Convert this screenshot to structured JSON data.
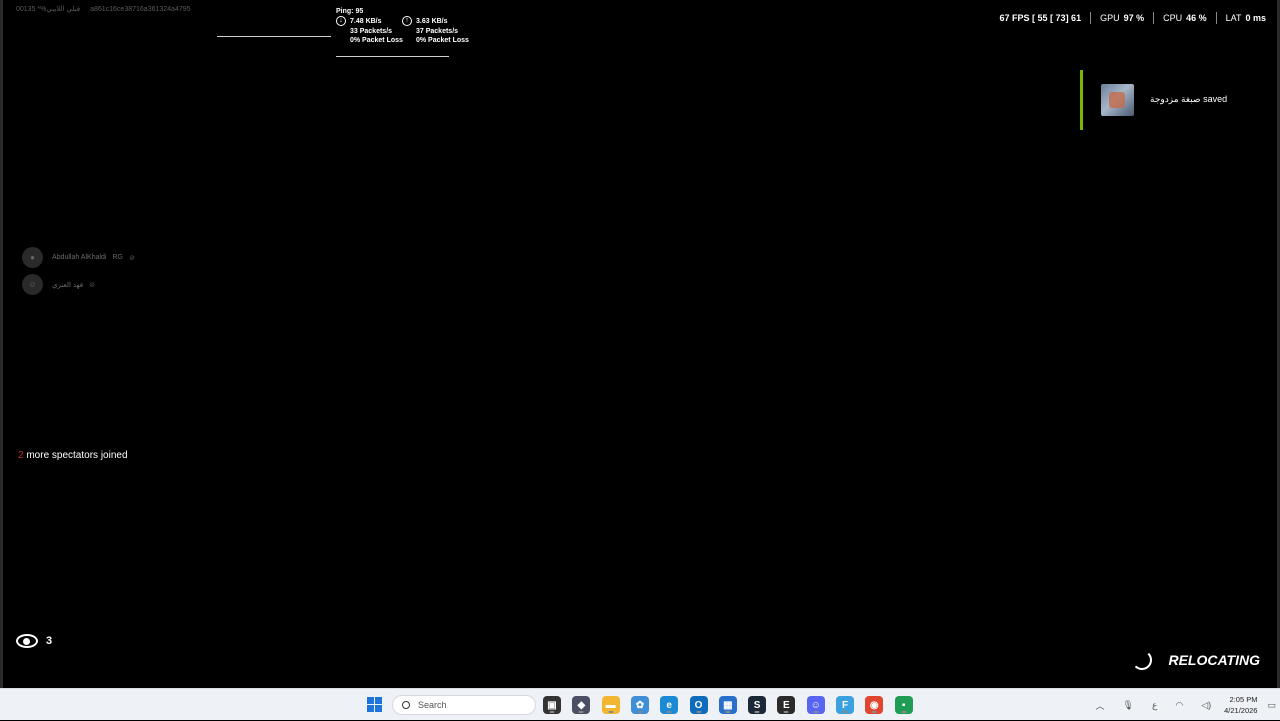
{
  "overlay": {
    "session_name": "قبلي اللايبي%*",
    "session_id": "00135a861c16ce38716a361324a4795",
    "network": {
      "ping": "Ping: 95",
      "download": {
        "rate": "7.48 KB/s",
        "packets": "33 Packets/s",
        "loss": "0% Packet Loss"
      },
      "upload": {
        "rate": "3.63 KB/s",
        "packets": "37 Packets/s",
        "loss": "0% Packet Loss"
      }
    },
    "perf": {
      "fps": "67 FPS [ 55 [ 73] 61",
      "gpu_label": "GPU",
      "gpu_value": "97 %",
      "cpu_label": "CPU",
      "cpu_value": "46 %",
      "lat_label": "LAT",
      "lat_value": "0 ms"
    },
    "notification": {
      "text": "صبغة مزدوجة saved",
      "accent": "#76b900"
    },
    "voice": [
      {
        "name": "Abdullah AlKhaldi",
        "badge": "RG",
        "icon": "avatar-icon"
      },
      {
        "name": "فهد العنزي",
        "badge": "",
        "icon": "discord-icon"
      }
    ],
    "spectators": {
      "count": "2",
      "text": "more spectators joined"
    },
    "viewers": "3",
    "status": "RELOCATING"
  },
  "taskbar": {
    "search_placeholder": "Search",
    "apps": [
      {
        "name": "task-view-icon",
        "color": "#333333",
        "glyph": "▣"
      },
      {
        "name": "app-cube-icon",
        "color": "#4a4f63",
        "glyph": "◆"
      },
      {
        "name": "file-explorer-icon",
        "color": "#f2b631",
        "glyph": "▬"
      },
      {
        "name": "photos-icon",
        "color": "#3f8ed8",
        "glyph": "✿"
      },
      {
        "name": "edge-icon",
        "color": "#1a8ad4",
        "glyph": "e"
      },
      {
        "name": "outlook-icon",
        "color": "#0f6cbd",
        "glyph": "O"
      },
      {
        "name": "store-icon",
        "color": "#2a6fc9",
        "glyph": "▦"
      },
      {
        "name": "steam-icon",
        "color": "#1b2838",
        "glyph": "S"
      },
      {
        "name": "epic-games-icon",
        "color": "#2b2b2b",
        "glyph": "E"
      },
      {
        "name": "discord-icon",
        "color": "#5865f2",
        "glyph": "☺"
      },
      {
        "name": "fortnite-icon",
        "color": "#3aa0e0",
        "glyph": "F"
      },
      {
        "name": "chrome-icon",
        "color": "#e0452f",
        "glyph": "◉"
      },
      {
        "name": "app-green-icon",
        "color": "#1f9d55",
        "glyph": "▪"
      }
    ],
    "tray": {
      "lang": "ع",
      "time": "2:05 PM",
      "date": "4/21/2026"
    }
  },
  "colors": {
    "spectator_count": "#c0262d",
    "taskbar_bg": "#eef1f6"
  }
}
